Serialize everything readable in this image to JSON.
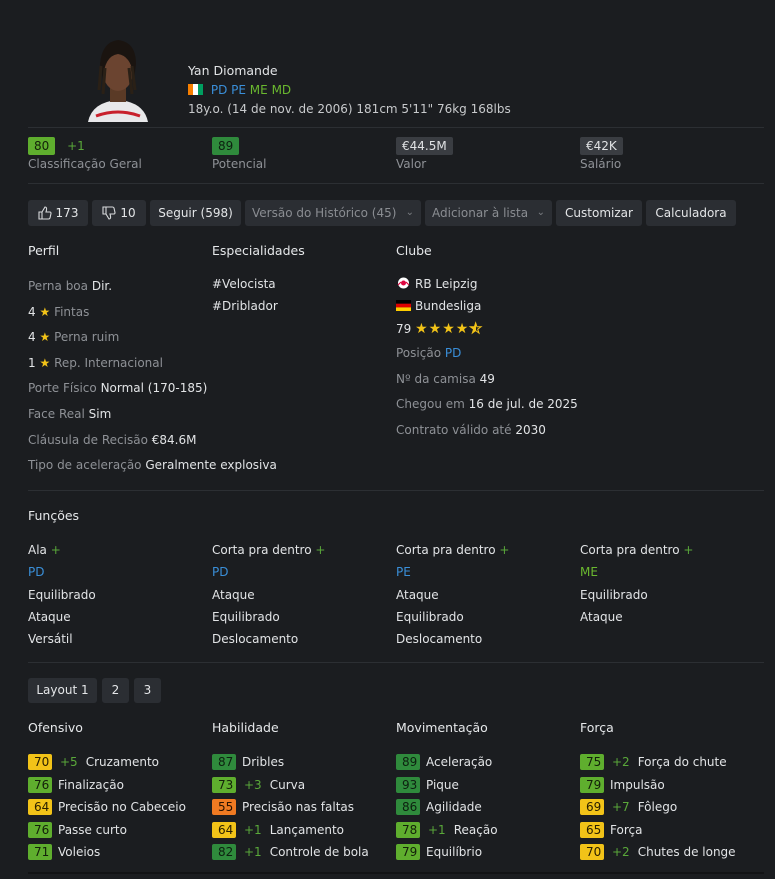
{
  "player": {
    "name": "Yan Diomande",
    "positions": [
      "PD",
      "PE",
      "ME",
      "MD"
    ],
    "bio": "18y.o. (14 de nov. de 2006) 181cm 5'11\" 76kg 168lbs"
  },
  "stats": {
    "overall": {
      "value": "80",
      "delta": "+1",
      "label": "Classificação Geral"
    },
    "potential": {
      "value": "89",
      "label": "Potencial"
    },
    "value": {
      "value": "€44.5M",
      "label": "Valor"
    },
    "wage": {
      "value": "€42K",
      "label": "Salário"
    }
  },
  "actions": {
    "likes": "173",
    "dislikes": "10",
    "follow": "Seguir (598)",
    "history": "Versão do Histórico (45)",
    "add_list": "Adicionar à lista",
    "customize": "Customizar",
    "calculator": "Calculadora"
  },
  "profile": {
    "title": "Perfil",
    "preferred_foot_label": "Perna boa",
    "preferred_foot": "Dir.",
    "skill_moves": "4",
    "skill_moves_label": "Fintas",
    "weak_foot": "4",
    "weak_foot_label": "Perna ruim",
    "intl_rep": "1",
    "intl_rep_label": "Rep. Internacional",
    "body_label": "Porte Físico",
    "body": "Normal (170-185)",
    "real_face_label": "Face Real",
    "real_face": "Sim",
    "release_label": "Cláusula de Recisão",
    "release": "€84.6M",
    "accel_label": "Tipo de aceleração",
    "accel": "Geralmente explosiva"
  },
  "specialities": {
    "title": "Especialidades",
    "items": [
      "#Velocista",
      "#Driblador"
    ]
  },
  "club": {
    "title": "Clube",
    "name": "RB Leipzig",
    "league": "Bundesliga",
    "rating": "79",
    "stars": 4.5,
    "position_label": "Posição",
    "position": "PD",
    "jersey_label": "Nº da camisa",
    "jersey": "49",
    "joined_label": "Chegou em",
    "joined": "16 de jul. de 2025",
    "contract_label": "Contrato válido até",
    "contract": "2030"
  },
  "roles": {
    "title": "Funções",
    "columns": [
      {
        "name": "Ala",
        "pos": "PD",
        "lines": [
          "Equilibrado",
          "Ataque",
          "Versátil"
        ]
      },
      {
        "name": "Corta pra dentro",
        "pos": "PD",
        "lines": [
          "Ataque",
          "Equilibrado",
          "Deslocamento"
        ]
      },
      {
        "name": "Corta pra dentro",
        "pos": "PE",
        "lines": [
          "Ataque",
          "Equilibrado",
          "Deslocamento"
        ]
      },
      {
        "name": "Corta pra dentro",
        "pos": "ME",
        "lines": [
          "Equilibrado",
          "Ataque"
        ]
      }
    ],
    "plus": "+"
  },
  "layout_tabs": [
    "Layout 1",
    "2",
    "3"
  ],
  "attributes": {
    "groups": [
      {
        "title": "Ofensivo",
        "items": [
          {
            "value": "70",
            "delta": "+5",
            "name": "Cruzamento",
            "color": "yellow"
          },
          {
            "value": "76",
            "delta": "",
            "name": "Finalização",
            "color": "green"
          },
          {
            "value": "64",
            "delta": "",
            "name": "Precisão no Cabeceio",
            "color": "yellow"
          },
          {
            "value": "76",
            "delta": "",
            "name": "Passe curto",
            "color": "green"
          },
          {
            "value": "71",
            "delta": "",
            "name": "Voleios",
            "color": "green"
          }
        ]
      },
      {
        "title": "Habilidade",
        "items": [
          {
            "value": "87",
            "delta": "",
            "name": "Dribles",
            "color": "dgreen"
          },
          {
            "value": "73",
            "delta": "+3",
            "name": "Curva",
            "color": "green"
          },
          {
            "value": "55",
            "delta": "",
            "name": "Precisão nas faltas",
            "color": "orange"
          },
          {
            "value": "64",
            "delta": "+1",
            "name": "Lançamento",
            "color": "yellow"
          },
          {
            "value": "82",
            "delta": "+1",
            "name": "Controle de bola",
            "color": "dgreen"
          }
        ]
      },
      {
        "title": "Movimentação",
        "items": [
          {
            "value": "89",
            "delta": "",
            "name": "Aceleração",
            "color": "dgreen"
          },
          {
            "value": "93",
            "delta": "",
            "name": "Pique",
            "color": "dgreen"
          },
          {
            "value": "86",
            "delta": "",
            "name": "Agilidade",
            "color": "dgreen"
          },
          {
            "value": "78",
            "delta": "+1",
            "name": "Reação",
            "color": "green"
          },
          {
            "value": "79",
            "delta": "",
            "name": "Equilíbrio",
            "color": "green"
          }
        ]
      },
      {
        "title": "Força",
        "items": [
          {
            "value": "75",
            "delta": "+2",
            "name": "Força do chute",
            "color": "green"
          },
          {
            "value": "79",
            "delta": "",
            "name": "Impulsão",
            "color": "green"
          },
          {
            "value": "69",
            "delta": "+7",
            "name": "Fôlego",
            "color": "yellow"
          },
          {
            "value": "65",
            "delta": "",
            "name": "Força",
            "color": "yellow"
          },
          {
            "value": "70",
            "delta": "+2",
            "name": "Chutes de longe",
            "color": "yellow"
          }
        ]
      }
    ]
  }
}
